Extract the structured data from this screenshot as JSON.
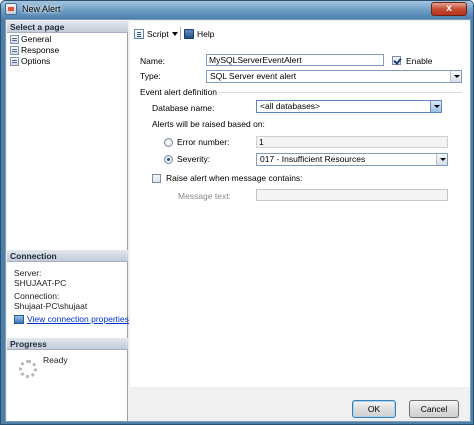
{
  "window": {
    "title": "New Alert",
    "close_glyph": "x"
  },
  "left": {
    "select_page_header": "Select a page",
    "pages": [
      "General",
      "Response",
      "Options"
    ],
    "connection_header": "Connection",
    "server_label": "Server:",
    "server_value": "SHUJAAT-PC",
    "connection_label": "Connection:",
    "connection_value": "Shujaat-PC\\shujaat",
    "view_connection_link": "View connection properties",
    "progress_header": "Progress",
    "progress_status": "Ready"
  },
  "toolbar": {
    "script_label": "Script",
    "help_label": "Help"
  },
  "form": {
    "name_label": "Name:",
    "name_value": "MySQLServerEventAlert",
    "enable_label": "Enable",
    "enable_checked": true,
    "type_label": "Type:",
    "type_value": "SQL Server event alert",
    "event_def_label": "Event alert definition",
    "database_label": "Database name:",
    "database_value": "<all databases>",
    "raised_label": "Alerts will be raised based on:",
    "error_number_label": "Error number:",
    "error_number_value": "1",
    "severity_label": "Severity:",
    "severity_value": "017 - Insufficient Resources",
    "raise_alert_label": "Raise alert when message contains:",
    "message_text_label": "Message text:",
    "message_text_value": ""
  },
  "buttons": {
    "ok": "OK",
    "cancel": "Cancel"
  }
}
